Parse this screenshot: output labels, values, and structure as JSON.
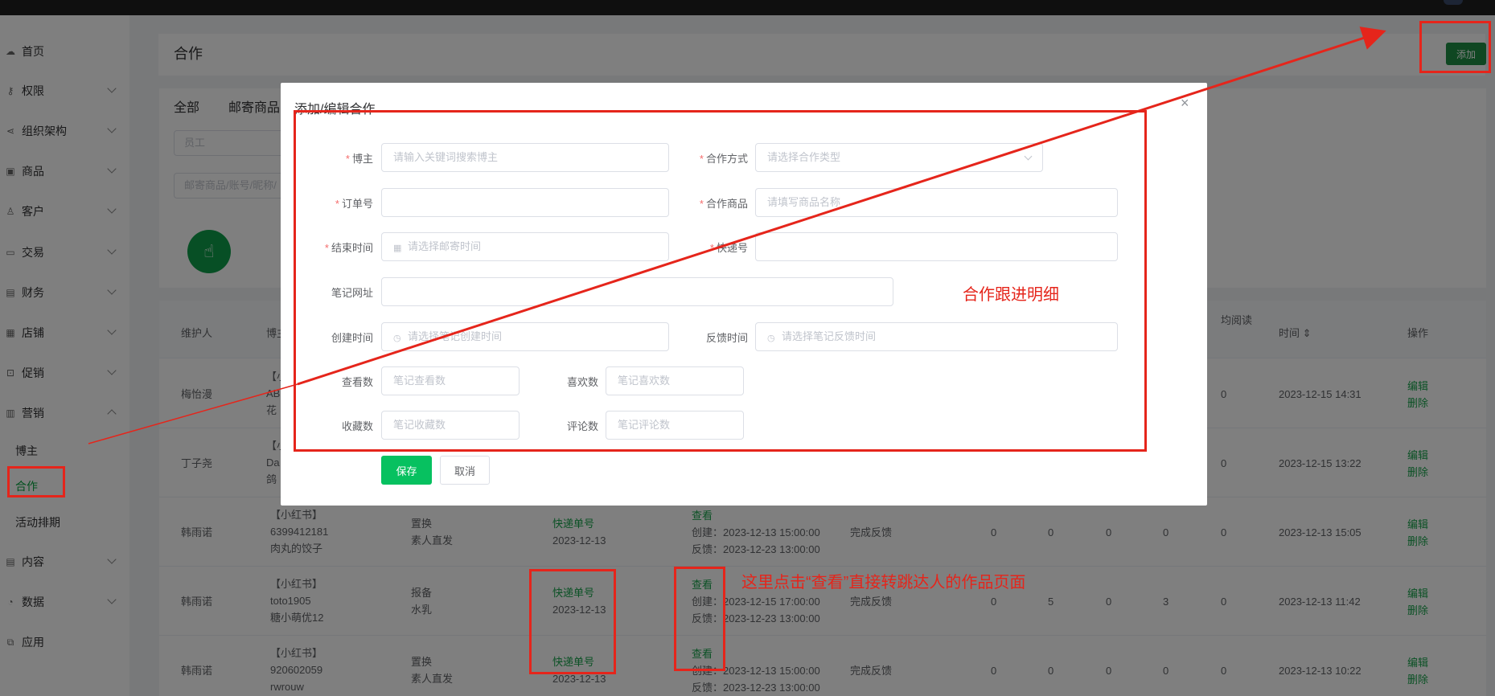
{
  "sidebar": {
    "items": [
      {
        "label": "首页",
        "icon": "cloud-icon"
      },
      {
        "label": "权限",
        "icon": "key-icon"
      },
      {
        "label": "组织架构",
        "icon": "share-icon"
      },
      {
        "label": "商品",
        "icon": "goods-icon"
      },
      {
        "label": "客户",
        "icon": "user-icon"
      },
      {
        "label": "交易",
        "icon": "folder-icon"
      },
      {
        "label": "财务",
        "icon": "wallet-icon"
      },
      {
        "label": "店铺",
        "icon": "shop-icon"
      },
      {
        "label": "促销",
        "icon": "bag-icon"
      },
      {
        "label": "营销",
        "icon": "gift-icon"
      },
      {
        "label": "内容",
        "icon": "document-icon"
      },
      {
        "label": "数据",
        "icon": "chart-icon"
      },
      {
        "label": "应用",
        "icon": "app-icon"
      }
    ],
    "sub_items": [
      "博主",
      "合作",
      "活动排期"
    ]
  },
  "header": {
    "title": "合作",
    "add_label": "添加"
  },
  "filters": {
    "tabs": [
      "全部",
      "邮寄商品"
    ],
    "staff_placeholder": "员工",
    "goods_placeholder": "邮寄商品/账号/昵称/"
  },
  "table": {
    "headers": [
      "维护人",
      "博主",
      "均阅读",
      "时间 ⇕",
      "操作"
    ],
    "rows": [
      {
        "owner": "梅怡漫",
        "blogger": [
          "【小",
          "AB",
          "花"
        ],
        "express": "",
        "date": "",
        "view": "",
        "created": "",
        "feedback": "",
        "status": "",
        "n1": "",
        "n2": "",
        "n3": "",
        "n4": "",
        "avg": "0",
        "time": "2023-12-15 14:31"
      },
      {
        "owner": "丁子尧",
        "blogger": [
          "【小",
          "Da",
          "鸽"
        ],
        "express": "",
        "date": "",
        "view": "",
        "created": "",
        "feedback": "",
        "status": "",
        "n1": "",
        "n2": "",
        "n3": "",
        "n4": "",
        "avg": "0",
        "time": "2023-12-15 13:22"
      },
      {
        "owner": "韩雨诺",
        "blogger": [
          "【小红书】",
          "6399412181",
          "肉丸的饺子"
        ],
        "mode": [
          "置换",
          "素人直发"
        ],
        "express": "快递单号",
        "date": "2023-12-13",
        "view": "查看",
        "created": "创建：2023-12-13 15:00:00",
        "feedback": "反馈：2023-12-23 13:00:00",
        "status": "完成反馈",
        "n1": "0",
        "n2": "0",
        "n3": "0",
        "n4": "0",
        "avg": "0",
        "time": "2023-12-13 15:05"
      },
      {
        "owner": "韩雨诺",
        "blogger": [
          "【小红书】",
          "toto1905",
          "糖小萌优12"
        ],
        "mode": [
          "报备",
          "水乳"
        ],
        "express": "快递单号",
        "date": "2023-12-13",
        "view": "查看",
        "created": "创建：2023-12-15 17:00:00",
        "feedback": "反馈：2023-12-23 13:00:00",
        "status": "完成反馈",
        "n1": "0",
        "n2": "5",
        "n3": "0",
        "n4": "3",
        "avg": "0",
        "time": "2023-12-13 11:42"
      },
      {
        "owner": "韩雨诺",
        "blogger": [
          "【小红书】",
          "920602059",
          "rwrouw"
        ],
        "mode": [
          "置换",
          "素人直发"
        ],
        "express": "快递单号",
        "date": "2023-12-13",
        "view": "查看",
        "created": "创建：2023-12-13 15:00:00",
        "feedback": "反馈：2023-12-23 13:00:00",
        "status": "完成反馈",
        "n1": "0",
        "n2": "0",
        "n3": "0",
        "n4": "0",
        "avg": "0",
        "time": "2023-12-13 10:22"
      }
    ],
    "edit_label": "编辑",
    "delete_label": "删除"
  },
  "dialog": {
    "title": "添加/编辑合作",
    "close": "×",
    "fields": {
      "blogger": {
        "label": "博主",
        "placeholder": "请输入关键词搜索博主"
      },
      "coop_mode": {
        "label": "合作方式",
        "placeholder": "请选择合作类型"
      },
      "order_no": {
        "label": "订单号",
        "placeholder": ""
      },
      "coop_goods": {
        "label": "合作商品",
        "placeholder": "请填写商品名称"
      },
      "end_time": {
        "label": "结束时间",
        "placeholder": "请选择邮寄时间"
      },
      "express_no": {
        "label": "快递号",
        "placeholder": ""
      },
      "note_url": {
        "label": "笔记网址",
        "placeholder": ""
      },
      "created_time": {
        "label": "创建时间",
        "placeholder": "请选择笔记创建时间"
      },
      "feedback_time": {
        "label": "反馈时间",
        "placeholder": "请选择笔记反馈时间"
      },
      "views": {
        "label": "查看数",
        "placeholder": "笔记查看数"
      },
      "likes": {
        "label": "喜欢数",
        "placeholder": "笔记喜欢数"
      },
      "collects": {
        "label": "收藏数",
        "placeholder": "笔记收藏数"
      },
      "comments": {
        "label": "评论数",
        "placeholder": "笔记评论数"
      }
    },
    "save_label": "保存",
    "cancel_label": "取消"
  },
  "annotations": {
    "detail_note": "合作跟进明细",
    "view_note": "这里点击“查看”直接转跳达人的作品页面"
  },
  "colors": {
    "accent": "#07c160",
    "annotation": "#e5251b",
    "link": "#16a34a"
  }
}
